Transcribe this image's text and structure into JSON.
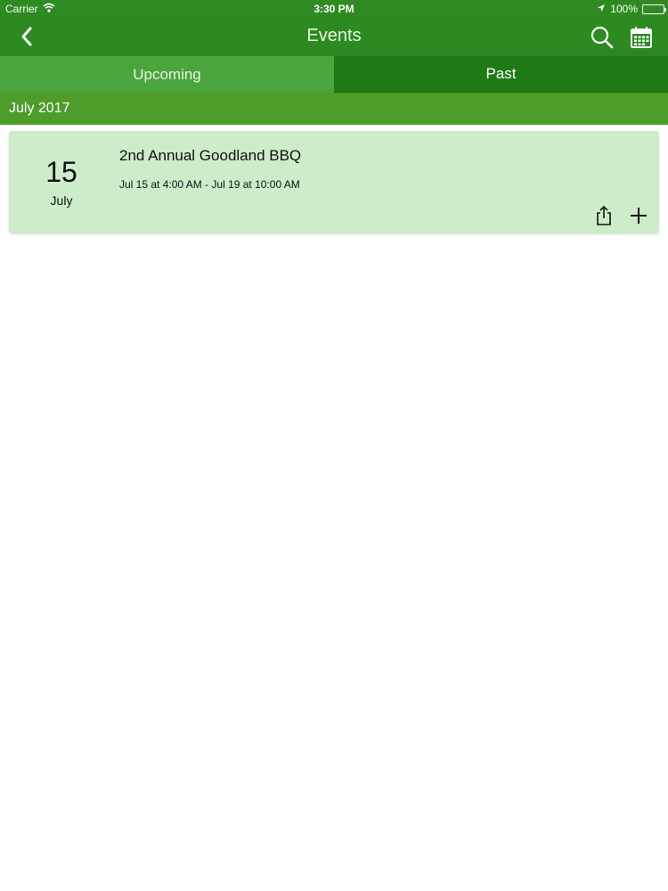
{
  "status": {
    "carrier": "Carrier",
    "time": "3:30 PM",
    "battery": "100%"
  },
  "nav": {
    "title": "Events",
    "icons": [
      "chevron-left-icon",
      "search-icon",
      "calendar-icon"
    ]
  },
  "tabs": [
    {
      "label": "Upcoming",
      "selected": true
    },
    {
      "label": "Past",
      "selected": false
    }
  ],
  "month_header": "July 2017",
  "events": [
    {
      "day": "15",
      "month": "July",
      "title": "2nd Annual Goodland BBQ",
      "time": "Jul 15 at 4:00 AM - Jul 19 at 10:00 AM"
    }
  ],
  "colors": {
    "navbar": "#2f8a22",
    "tab_upcoming": "#4aa63c",
    "tab_past": "#1f7a16",
    "month_header": "#4e9c2a",
    "card": "#ccecca"
  }
}
